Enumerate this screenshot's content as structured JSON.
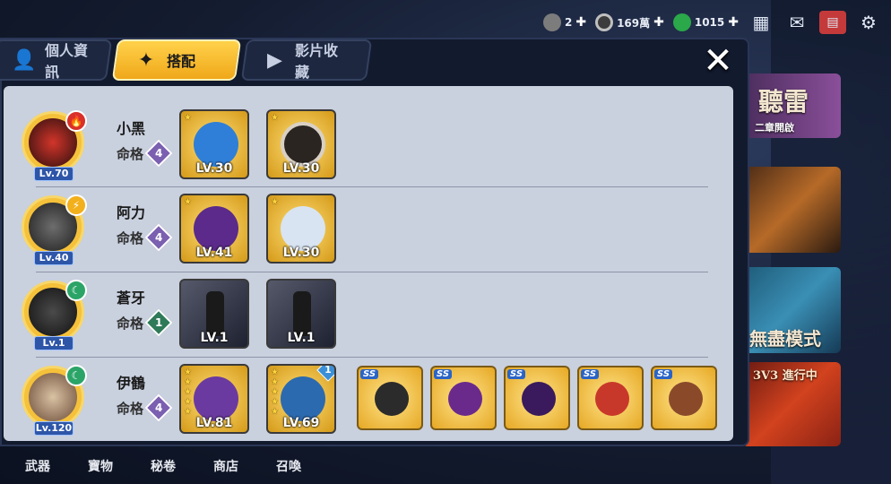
{
  "topbar": {
    "res1": "2",
    "res2": "169萬",
    "res3": "1015",
    "icons": [
      "calendar-icon",
      "mail-icon",
      "shop-icon",
      "gear-icon"
    ]
  },
  "tabs": [
    {
      "label": "個人資訊",
      "icon": "profile-icon"
    },
    {
      "label": "搭配",
      "icon": "shuriken-icon"
    },
    {
      "label": "影片收藏",
      "icon": "play-icon"
    }
  ],
  "banners": [
    {
      "text": "聽雷",
      "sub": "二章開啟"
    },
    {
      "text": ""
    },
    {
      "text": "無盡模式"
    },
    {
      "text": "3V3 進行中"
    }
  ],
  "fate_label": "命格",
  "characters": [
    {
      "name": "小黑",
      "level": "Lv.70",
      "fate": "4",
      "element_color": "#d9302a",
      "items": [
        {
          "lv": "LV.30",
          "stars": 1
        },
        {
          "lv": "LV.30",
          "stars": 1
        }
      ]
    },
    {
      "name": "阿力",
      "level": "Lv.40",
      "fate": "4",
      "element_color": "#f2b01c",
      "items": [
        {
          "lv": "LV.41",
          "stars": 1
        },
        {
          "lv": "LV.30",
          "stars": 1
        }
      ]
    },
    {
      "name": "蒼牙",
      "level": "Lv.1",
      "fate": "1",
      "element_color": "#2ba468",
      "items": [
        {
          "lv": "LV.1",
          "stars": 0
        },
        {
          "lv": "LV.1",
          "stars": 0
        }
      ]
    },
    {
      "name": "伊鶴",
      "level": "Lv.120",
      "fate": "4",
      "element_color": "#2ba468",
      "items": [
        {
          "lv": "LV.81",
          "stars": 5
        },
        {
          "lv": "LV.69",
          "stars": 5,
          "badge": "1"
        }
      ],
      "ss_items": [
        "SS",
        "SS",
        "SS",
        "SS",
        "SS"
      ]
    }
  ],
  "bottomnav": [
    "武器",
    "寶物",
    "秘卷",
    "商店",
    "召喚"
  ]
}
